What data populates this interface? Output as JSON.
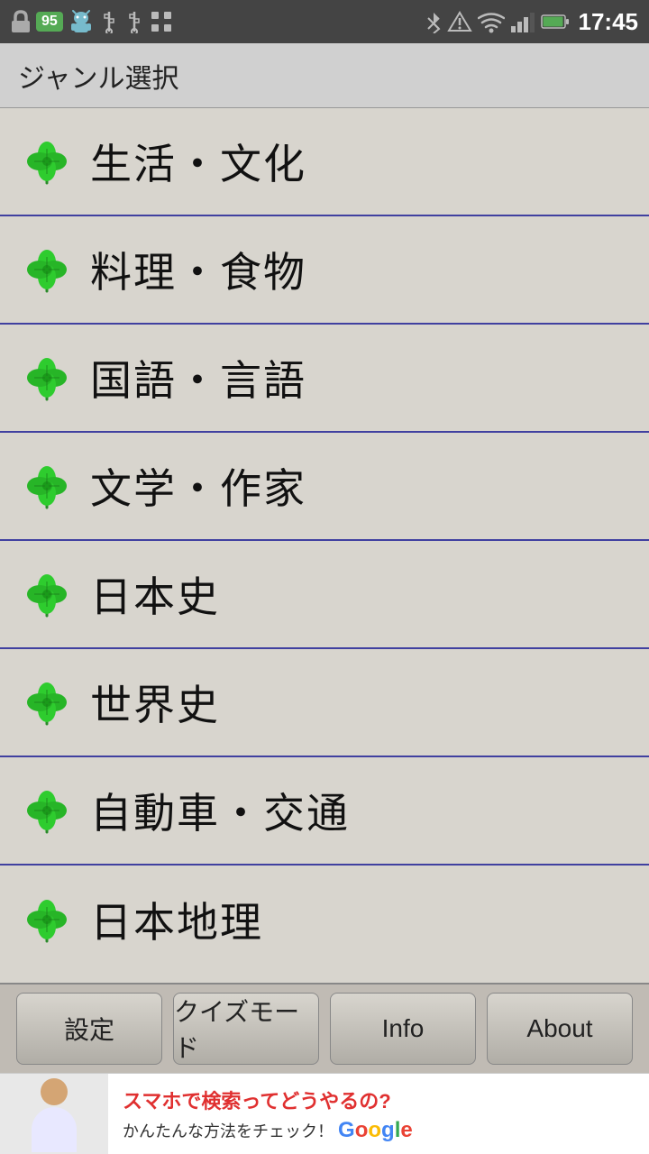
{
  "statusBar": {
    "time": "17:45",
    "batteryLevel": "95"
  },
  "titleBar": {
    "title": "ジャンル選択"
  },
  "menuItems": [
    {
      "id": 1,
      "label": "生活・文化"
    },
    {
      "id": 2,
      "label": "料理・食物"
    },
    {
      "id": 3,
      "label": "国語・言語"
    },
    {
      "id": 4,
      "label": "文学・作家"
    },
    {
      "id": 5,
      "label": "日本史"
    },
    {
      "id": 6,
      "label": "世界史"
    },
    {
      "id": 7,
      "label": "自動車・交通"
    },
    {
      "id": 8,
      "label": "日本地理"
    }
  ],
  "bottomNav": {
    "buttons": [
      {
        "id": "settings",
        "label": "設定"
      },
      {
        "id": "quiz-mode",
        "label": "クイズモード"
      },
      {
        "id": "info",
        "label": "Info"
      },
      {
        "id": "about",
        "label": "About"
      }
    ]
  },
  "ad": {
    "mainText": "スマホで検索ってどうやるの?",
    "subText": "かんたんな方法をチェック！",
    "brandName": "Google"
  }
}
